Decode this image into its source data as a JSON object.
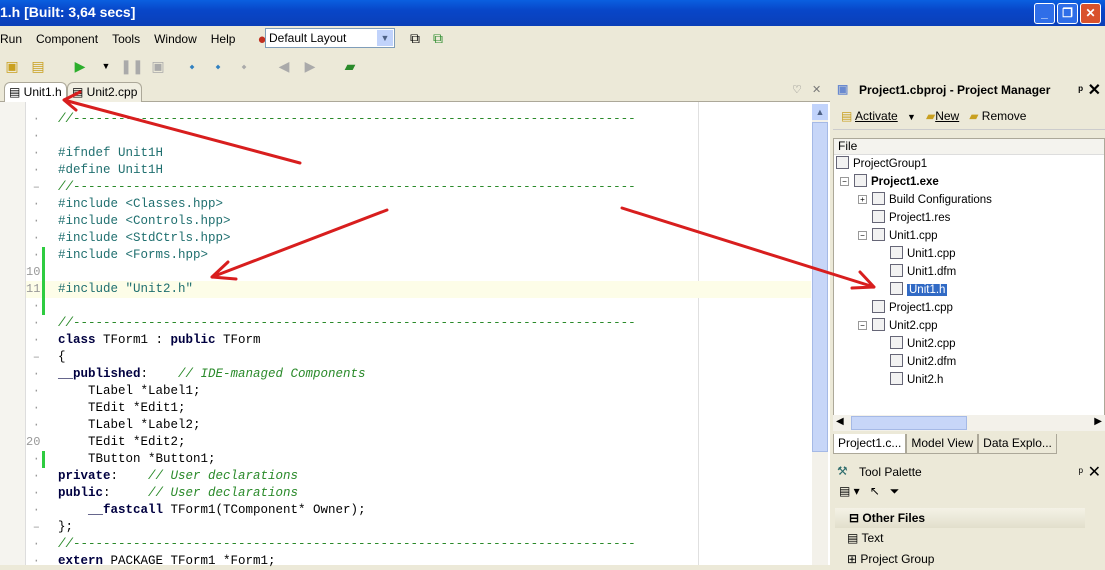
{
  "window": {
    "title": "1.h [Built: 3,64 secs]"
  },
  "menu": [
    "Run",
    "Component",
    "Tools",
    "Window",
    "Help"
  ],
  "layout_select": {
    "value": "Default Layout"
  },
  "editor_tabs": [
    {
      "label": "Unit1.h",
      "active": true
    },
    {
      "label": "Unit2.cpp",
      "active": false
    }
  ],
  "code_lines": [
    {
      "n": "·",
      "t": "//---------------------------------------------------------------------------",
      "c": "cm"
    },
    {
      "n": "·",
      "t": "",
      "c": ""
    },
    {
      "n": "·",
      "t": "#ifndef Unit1H",
      "c": "pp"
    },
    {
      "n": "·",
      "t": "#define Unit1H",
      "c": "pp"
    },
    {
      "n": "–",
      "t": "//---------------------------------------------------------------------------",
      "c": "cm"
    },
    {
      "n": "·",
      "t": "#include <Classes.hpp>",
      "c": "pp"
    },
    {
      "n": "·",
      "t": "#include <Controls.hpp>",
      "c": "pp"
    },
    {
      "n": "·",
      "t": "#include <StdCtrls.hpp>",
      "c": "pp"
    },
    {
      "n": "·",
      "t": "#include <Forms.hpp>",
      "c": "pp",
      "mod": true
    },
    {
      "n": "10",
      "t": "",
      "c": "",
      "mod": true
    },
    {
      "n": "11",
      "t": "#include \"Unit2.h\"",
      "c": "pp",
      "mod": true,
      "cur": true
    },
    {
      "n": "·",
      "t": "",
      "c": "",
      "mod": true
    },
    {
      "n": "·",
      "t": "//---------------------------------------------------------------------------",
      "c": "cm"
    },
    {
      "n": "·",
      "t": "class TForm1 : public TForm",
      "c": "kwline"
    },
    {
      "n": "–",
      "t": "{",
      "c": ""
    },
    {
      "n": "·",
      "t": "__published:    // IDE-managed Components",
      "c": "kwline"
    },
    {
      "n": "·",
      "t": "    TLabel *Label1;",
      "c": ""
    },
    {
      "n": "·",
      "t": "    TEdit *Edit1;",
      "c": ""
    },
    {
      "n": "·",
      "t": "    TLabel *Label2;",
      "c": ""
    },
    {
      "n": "20",
      "t": "    TEdit *Edit2;",
      "c": ""
    },
    {
      "n": "·",
      "t": "    TButton *Button1;",
      "c": "",
      "mod": true
    },
    {
      "n": "·",
      "t": "private:    // User declarations",
      "c": "kwline"
    },
    {
      "n": "·",
      "t": "public:     // User declarations",
      "c": "kwline"
    },
    {
      "n": "·",
      "t": "    __fastcall TForm1(TComponent* Owner);",
      "c": "kwline"
    },
    {
      "n": "–",
      "t": "};",
      "c": ""
    },
    {
      "n": "·",
      "t": "//---------------------------------------------------------------------------",
      "c": "cm"
    },
    {
      "n": "·",
      "t": "extern PACKAGE TForm1 *Form1;",
      "c": "kwline"
    }
  ],
  "project_manager": {
    "title": "Project1.cbproj - Project Manager",
    "activate": "Activate",
    "new": "New",
    "remove": "Remove",
    "column": "File",
    "nodes": [
      {
        "label": "ProjectGroup1",
        "level": 0
      },
      {
        "label": "Project1.exe",
        "level": 1,
        "bold": true,
        "exp": "-"
      },
      {
        "label": "Build Configurations",
        "level": 2,
        "exp": "+"
      },
      {
        "label": "Project1.res",
        "level": 2
      },
      {
        "label": "Unit1.cpp",
        "level": 2,
        "exp": "-"
      },
      {
        "label": "Unit1.cpp",
        "level": 3
      },
      {
        "label": "Unit1.dfm",
        "level": 3
      },
      {
        "label": "Unit1.h",
        "level": 3,
        "selected": true
      },
      {
        "label": "Project1.cpp",
        "level": 2
      },
      {
        "label": "Unit2.cpp",
        "level": 2,
        "exp": "-"
      },
      {
        "label": "Unit2.cpp",
        "level": 3
      },
      {
        "label": "Unit2.dfm",
        "level": 3
      },
      {
        "label": "Unit2.h",
        "level": 3
      }
    ]
  },
  "bottom_tabs": [
    "Project1.c...",
    "Model View",
    "Data Explo..."
  ],
  "tool_palette": {
    "title": "Tool Palette",
    "category": "Other Files",
    "items": [
      "Text",
      "Project Group"
    ]
  },
  "colors": {
    "annotation_arrow": "#d81e1e",
    "selection": "#316ac5"
  }
}
